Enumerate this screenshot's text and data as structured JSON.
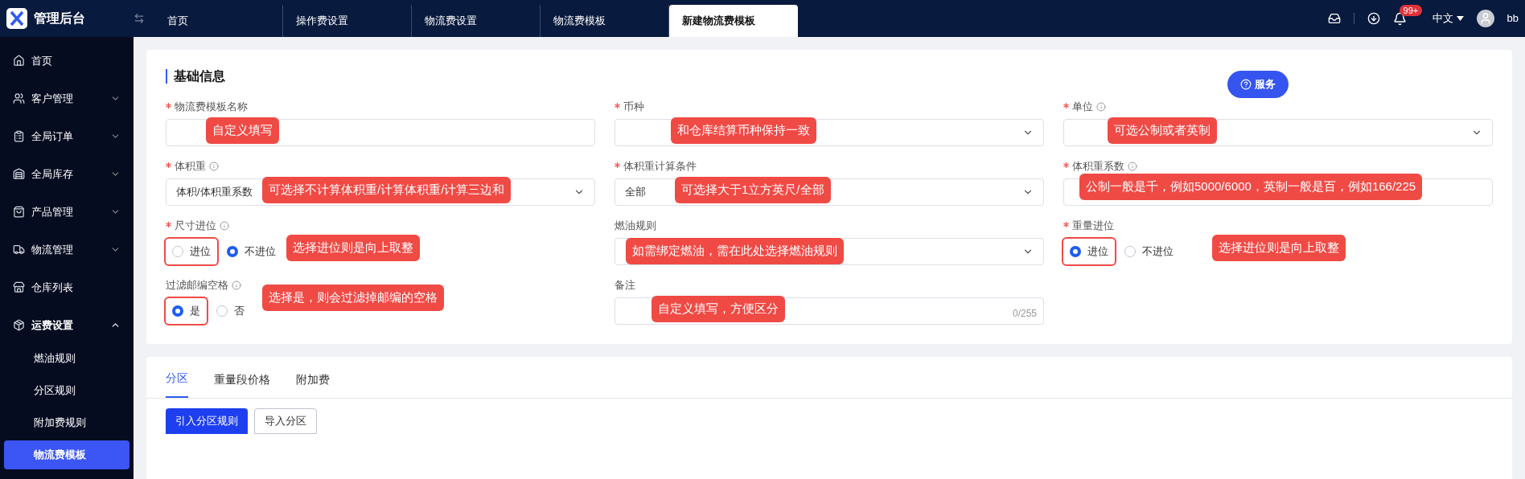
{
  "app": {
    "title": "管理后台"
  },
  "tabs": [
    {
      "label": "首页",
      "selected": false
    },
    {
      "label": "操作费设置",
      "selected": false
    },
    {
      "label": "物流费设置",
      "selected": false
    },
    {
      "label": "物流费模板",
      "selected": false
    },
    {
      "label": "新建物流费模板",
      "selected": true
    }
  ],
  "header": {
    "notification_count": "99+",
    "language": "中文",
    "user": "bb"
  },
  "sidebar": {
    "items": [
      {
        "label": "首页"
      },
      {
        "label": "客户管理",
        "expanded": false
      },
      {
        "label": "全局订单",
        "expanded": false
      },
      {
        "label": "全局库存",
        "expanded": false
      },
      {
        "label": "产品管理",
        "expanded": false
      },
      {
        "label": "物流管理",
        "expanded": false
      },
      {
        "label": "仓库列表"
      },
      {
        "label": "运费设置",
        "expanded": true,
        "children": [
          {
            "label": "燃油规则",
            "selected": false
          },
          {
            "label": "分区规则",
            "selected": false
          },
          {
            "label": "附加费规则",
            "selected": false
          },
          {
            "label": "物流费模板",
            "selected": true
          }
        ]
      }
    ]
  },
  "service_button": "服务",
  "section_title": "基础信息",
  "fields": [
    {
      "kind": "input",
      "label": "物流费模板名称",
      "required": true,
      "info": false,
      "callout": "自定义填写"
    },
    {
      "kind": "select",
      "label": "币种",
      "required": true,
      "info": false,
      "callout": "和仓库结算币种保持一致"
    },
    {
      "kind": "select",
      "label": "单位",
      "required": true,
      "info": true,
      "callout": "可选公制或者英制"
    },
    {
      "kind": "select",
      "label": "体积重",
      "required": true,
      "info": true,
      "value": "体积/体积重系数",
      "callout": "可选择不计算体积重/计算体积重/计算三边和"
    },
    {
      "kind": "select",
      "label": "体积重计算条件",
      "required": true,
      "info": false,
      "value": "全部",
      "callout": "可选择大于1立方英尺/全部"
    },
    {
      "kind": "input",
      "label": "体积重系数",
      "required": true,
      "info": true,
      "callout": "公制一般是千，例如5000/6000，英制一般是百，例如166/225"
    },
    {
      "kind": "radio",
      "label": "尺寸进位",
      "required": true,
      "info": true,
      "options": [
        {
          "label": "进位",
          "selected": false,
          "highlighted": true
        },
        {
          "label": "不进位",
          "selected": true,
          "highlighted": false
        }
      ],
      "callout": "选择进位则是向上取整"
    },
    {
      "kind": "select",
      "label": "燃油规则",
      "required": false,
      "info": false,
      "callout": "如需绑定燃油，需在此处选择燃油规则"
    },
    {
      "kind": "radio",
      "label": "重量进位",
      "required": true,
      "info": false,
      "options": [
        {
          "label": "进位",
          "selected": true,
          "highlighted": true
        },
        {
          "label": "不进位",
          "selected": false,
          "highlighted": false
        }
      ],
      "callout": "选择进位则是向上取整"
    },
    {
      "kind": "radio",
      "label": "过滤邮编空格",
      "required": false,
      "info": true,
      "options": [
        {
          "label": "是",
          "selected": true,
          "highlighted": true
        },
        {
          "label": "否",
          "selected": false,
          "highlighted": false
        }
      ],
      "callout": "选择是，则会过滤掉邮编的空格"
    },
    {
      "kind": "textarea",
      "label": "备注",
      "required": false,
      "info": false,
      "counter": "0/255",
      "callout": "自定义填写，方便区分"
    }
  ],
  "sub_tabs": [
    {
      "label": "分区",
      "selected": true
    },
    {
      "label": "重量段价格",
      "selected": false
    },
    {
      "label": "附加费",
      "selected": false
    }
  ],
  "actions": [
    {
      "label": "引入分区规则",
      "kind": "primary"
    },
    {
      "label": "导入分区",
      "kind": "default"
    }
  ]
}
